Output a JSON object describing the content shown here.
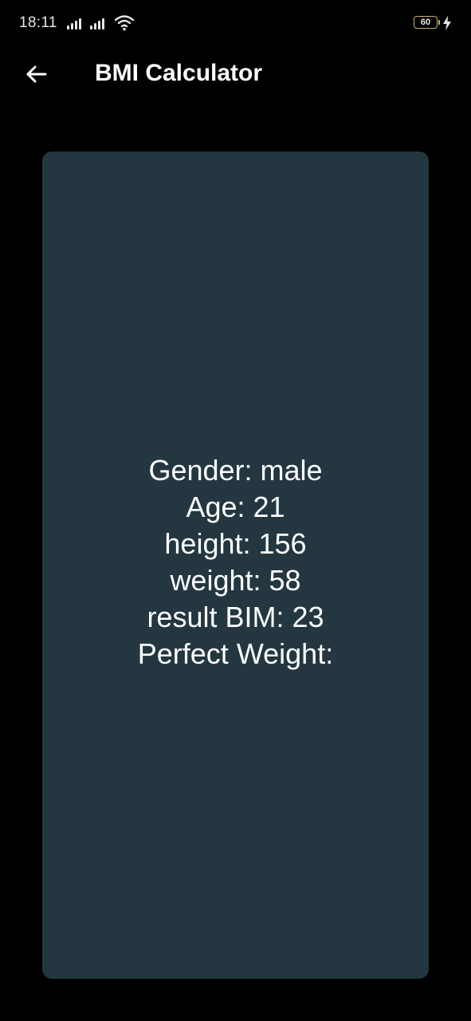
{
  "status_bar": {
    "time": "18:11",
    "battery_level": "60",
    "signal_strength": [
      4,
      4
    ],
    "icons": [
      "signal-icon",
      "signal-icon",
      "wifi-icon",
      "battery-icon",
      "charging-icon"
    ]
  },
  "app_bar": {
    "back_icon": "arrow-left-icon",
    "title": "BMI Calculator"
  },
  "result": {
    "gender": "Gender: male",
    "age": "Age: 21",
    "height": "height: 156",
    "weight": "weight: 58",
    "bmi": "result BIM: 23",
    "perfect_weight": "Perfect Weight:"
  },
  "colors": {
    "background": "#000000",
    "card": "#243741",
    "text": "#ffffff",
    "battery_outline": "#c9b27a"
  }
}
